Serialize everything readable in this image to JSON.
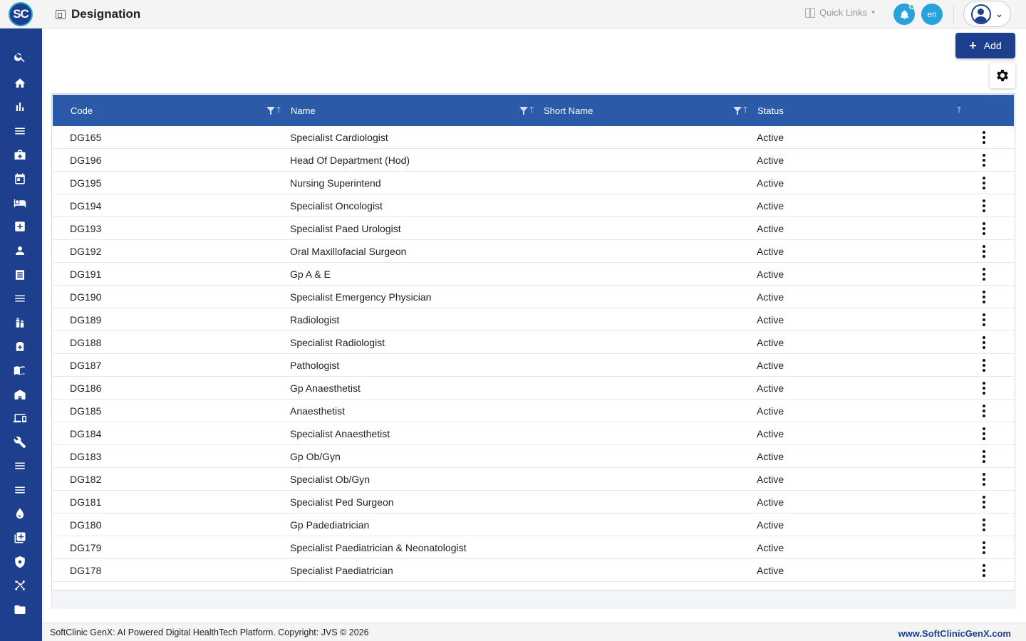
{
  "header": {
    "logo_text": "SC",
    "title": "Designation",
    "quick_links": "Quick Links",
    "lang": "en"
  },
  "toolbar": {
    "add_label": "Add"
  },
  "table": {
    "columns": [
      "Code",
      "Name",
      "Short Name",
      "Status"
    ],
    "rows": [
      {
        "code": "DG165",
        "name": "Specialist Cardiologist",
        "short_name": "",
        "status": "Active"
      },
      {
        "code": "DG196",
        "name": "Head Of Department (Hod)",
        "short_name": "",
        "status": "Active"
      },
      {
        "code": "DG195",
        "name": "Nursing Superintend",
        "short_name": "",
        "status": "Active"
      },
      {
        "code": "DG194",
        "name": "Specialist Oncologist",
        "short_name": "",
        "status": "Active"
      },
      {
        "code": "DG193",
        "name": "Specialist Paed Urologist",
        "short_name": "",
        "status": "Active"
      },
      {
        "code": "DG192",
        "name": "Oral Maxillofacial Surgeon",
        "short_name": "",
        "status": "Active"
      },
      {
        "code": "DG191",
        "name": "Gp A & E",
        "short_name": "",
        "status": "Active"
      },
      {
        "code": "DG190",
        "name": "Specialist Emergency Physician",
        "short_name": "",
        "status": "Active"
      },
      {
        "code": "DG189",
        "name": "Radiologist",
        "short_name": "",
        "status": "Active"
      },
      {
        "code": "DG188",
        "name": "Specialist Radiologist",
        "short_name": "",
        "status": "Active"
      },
      {
        "code": "DG187",
        "name": "Pathologist",
        "short_name": "",
        "status": "Active"
      },
      {
        "code": "DG186",
        "name": "Gp Anaesthetist",
        "short_name": "",
        "status": "Active"
      },
      {
        "code": "DG185",
        "name": "Anaesthetist",
        "short_name": "",
        "status": "Active"
      },
      {
        "code": "DG184",
        "name": "Specialist Anaesthetist",
        "short_name": "",
        "status": "Active"
      },
      {
        "code": "DG183",
        "name": "Gp Ob/Gyn",
        "short_name": "",
        "status": "Active"
      },
      {
        "code": "DG182",
        "name": "Specialist Ob/Gyn",
        "short_name": "",
        "status": "Active"
      },
      {
        "code": "DG181",
        "name": "Specialist Ped Surgeon",
        "short_name": "",
        "status": "Active"
      },
      {
        "code": "DG180",
        "name": "Gp Padediatrician",
        "short_name": "",
        "status": "Active"
      },
      {
        "code": "DG179",
        "name": "Specialist Paediatrician & Neonatologist",
        "short_name": "",
        "status": "Active"
      },
      {
        "code": "DG178",
        "name": "Specialist Paediatrician",
        "short_name": "",
        "status": "Active"
      }
    ]
  },
  "sidebar": {
    "icons": [
      "search-icon",
      "home-icon",
      "bar-chart-icon",
      "menu-icon",
      "medical-bag-icon",
      "calendar-icon",
      "bed-icon",
      "hospital-plus-icon",
      "person-icon",
      "list-document-icon",
      "menu-icon",
      "medication-icon",
      "pharmacy-icon",
      "book-icon",
      "building-icon",
      "devices-icon",
      "wrench-icon",
      "menu-icon",
      "menu-icon",
      "blood-drop-icon",
      "add-box-icon",
      "shield-icon",
      "network-icon",
      "folder-icon"
    ]
  },
  "footer": {
    "copyright": "SoftClinic GenX: AI Powered Digital HealthTech Platform. Copyright: JVS © 2026",
    "website": "www.SoftClinicGenX.com"
  },
  "colors": {
    "brand": "#1e3f8e",
    "table_header": "#2a5aa8",
    "accent": "#26a2dc"
  }
}
